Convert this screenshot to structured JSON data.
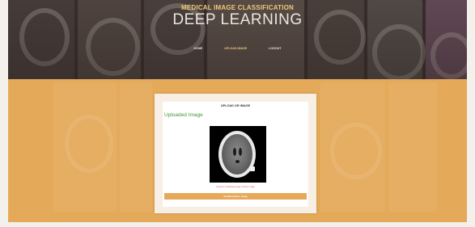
{
  "header": {
    "kicker": "MEDICAL IMAGE CLASSIFICATION",
    "title": "DEEP LEARNING"
  },
  "nav": {
    "items": [
      {
        "label": "HOME",
        "active": false
      },
      {
        "label": "UPLOAD IMAGE",
        "active": true
      },
      {
        "label": "LOGOUT",
        "active": false
      }
    ]
  },
  "card": {
    "title": "UPLOAD OR IMAGE",
    "section_heading": "Uploaded Image",
    "caption": "Scanner: Predicted image or fill an image",
    "predict_button": "Predict (tumor drug)"
  },
  "colors": {
    "accent": "#e5a95a",
    "header_dark": "#3a2f2c",
    "kicker": "#f2c879",
    "heading_green": "#3c9a3c",
    "caption_red": "#d9534f"
  }
}
